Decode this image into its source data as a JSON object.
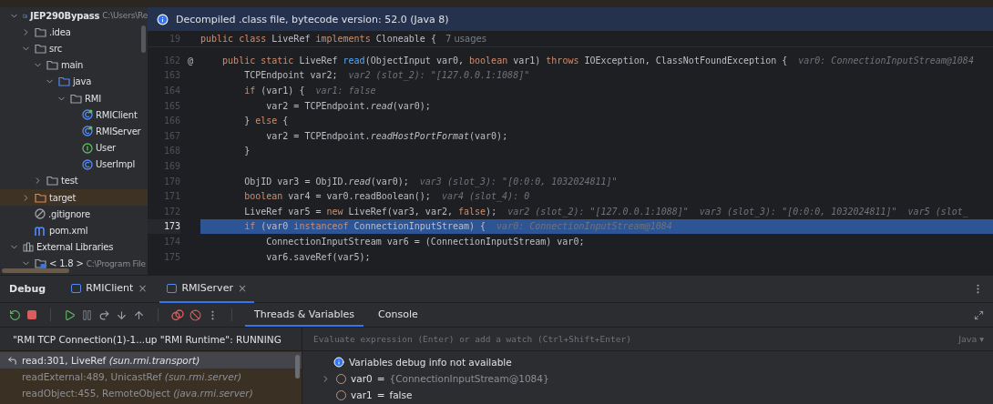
{
  "project_tree": [
    {
      "label": "JEP290Bypass",
      "hint": "C:\\Users\\Re",
      "kind": "module",
      "expanded": true,
      "children": [
        {
          "label": ".idea",
          "kind": "folder",
          "expanded": false
        },
        {
          "label": "src",
          "kind": "folder",
          "expanded": true,
          "children": [
            {
              "label": "main",
              "kind": "folder",
              "expanded": true,
              "children": [
                {
                  "label": "java",
                  "kind": "source-folder",
                  "expanded": true,
                  "children": [
                    {
                      "label": "RMI",
                      "kind": "package",
                      "expanded": true,
                      "children": [
                        {
                          "label": "RMIClient",
                          "kind": "main-class"
                        },
                        {
                          "label": "RMIServer",
                          "kind": "main-class"
                        },
                        {
                          "label": "User",
                          "kind": "interface"
                        },
                        {
                          "label": "UserImpl",
                          "kind": "class"
                        }
                      ]
                    }
                  ]
                }
              ]
            },
            {
              "label": "test",
              "kind": "folder",
              "expanded": false
            }
          ]
        },
        {
          "label": "target",
          "kind": "excluded-folder",
          "expanded": false
        },
        {
          "label": ".gitignore",
          "kind": "ignore"
        },
        {
          "label": "pom.xml",
          "kind": "maven"
        }
      ]
    },
    {
      "label": "External Libraries",
      "kind": "library",
      "expanded": true,
      "children": [
        {
          "label": "< 1.8 >",
          "hint": "C:\\Program File",
          "kind": "jdk",
          "expanded": true
        }
      ]
    }
  ],
  "banner": {
    "text": "Decompiled .class file, bytecode version: 52.0 (Java 8)"
  },
  "sticky_line": {
    "number": "19",
    "tokens": [
      {
        "kind": "kw",
        "text": "public class "
      },
      {
        "kind": "plain",
        "text": "LiveRef "
      },
      {
        "kind": "kw",
        "text": "implements "
      },
      {
        "kind": "plain",
        "text": "Cloneable {"
      },
      {
        "kind": "usage",
        "text": "7 usages"
      }
    ]
  },
  "code_lines": [
    {
      "number": "162",
      "marker": "@",
      "current": false,
      "tokens": [
        {
          "kind": "kw",
          "text": "    public static "
        },
        {
          "kind": "plain",
          "text": "LiveRef "
        },
        {
          "kind": "decl",
          "text": "read"
        },
        {
          "kind": "plain",
          "text": "(ObjectInput var0, "
        },
        {
          "kind": "kw",
          "text": "boolean "
        },
        {
          "kind": "plain",
          "text": "var1) "
        },
        {
          "kind": "kw",
          "text": "throws "
        },
        {
          "kind": "plain",
          "text": "IOException, ClassNotFoundException {"
        },
        {
          "kind": "hint",
          "text": "var0: ConnectionInputStream@1084"
        }
      ]
    },
    {
      "number": "163",
      "current": false,
      "tokens": [
        {
          "kind": "plain",
          "text": "        TCPEndpoint var2;"
        },
        {
          "kind": "hint",
          "text": "var2 (slot_2): \"[127.0.0.1:1088]\""
        }
      ]
    },
    {
      "number": "164",
      "current": false,
      "tokens": [
        {
          "kind": "kw",
          "text": "        if "
        },
        {
          "kind": "plain",
          "text": "(var1) {"
        },
        {
          "kind": "hint",
          "text": "var1: false"
        }
      ]
    },
    {
      "number": "165",
      "current": false,
      "tokens": [
        {
          "kind": "plain",
          "text": "            var2 = TCPEndpoint."
        },
        {
          "kind": "static",
          "text": "read"
        },
        {
          "kind": "plain",
          "text": "(var0);"
        }
      ]
    },
    {
      "number": "166",
      "current": false,
      "tokens": [
        {
          "kind": "plain",
          "text": "        } "
        },
        {
          "kind": "kw",
          "text": "else "
        },
        {
          "kind": "plain",
          "text": "{"
        }
      ]
    },
    {
      "number": "167",
      "current": false,
      "tokens": [
        {
          "kind": "plain",
          "text": "            var2 = TCPEndpoint."
        },
        {
          "kind": "static",
          "text": "readHostPortFormat"
        },
        {
          "kind": "plain",
          "text": "(var0);"
        }
      ]
    },
    {
      "number": "168",
      "current": false,
      "tokens": [
        {
          "kind": "plain",
          "text": "        }"
        }
      ]
    },
    {
      "number": "169",
      "current": false
    },
    {
      "number": "170",
      "current": false,
      "tokens": [
        {
          "kind": "plain",
          "text": "        ObjID var3 = ObjID."
        },
        {
          "kind": "static",
          "text": "read"
        },
        {
          "kind": "plain",
          "text": "(var0);"
        },
        {
          "kind": "hint",
          "text": "var3 (slot_3): \"[0:0:0, 1032024811]\""
        }
      ]
    },
    {
      "number": "171",
      "current": false,
      "tokens": [
        {
          "kind": "kw",
          "text": "        boolean "
        },
        {
          "kind": "plain",
          "text": "var4 = var0.readBoolean();"
        },
        {
          "kind": "hint",
          "text": "var4 (slot_4): 0"
        }
      ]
    },
    {
      "number": "172",
      "current": false,
      "tokens": [
        {
          "kind": "plain",
          "text": "        LiveRef var5 = "
        },
        {
          "kind": "kw",
          "text": "new "
        },
        {
          "kind": "plain",
          "text": "LiveRef(var3, var2, "
        },
        {
          "kind": "kw",
          "text": "false"
        },
        {
          "kind": "plain",
          "text": ");"
        },
        {
          "kind": "hint",
          "text": "var2 (slot_2): \"[127.0.0.1:1088]\""
        },
        {
          "kind": "hint",
          "text": "var3 (slot_3): \"[0:0:0, 1032024811]\""
        },
        {
          "kind": "hint",
          "text": "var5 (slot_"
        }
      ]
    },
    {
      "number": "173",
      "current": true,
      "tokens": [
        {
          "kind": "kw",
          "text": "        if "
        },
        {
          "kind": "plain",
          "text": "(var0 "
        },
        {
          "kind": "kw",
          "text": "instanceof "
        },
        {
          "kind": "plain",
          "text": "ConnectionInputStream) {"
        },
        {
          "kind": "hint",
          "text": "var0: ConnectionInputStream@1084"
        }
      ]
    },
    {
      "number": "174",
      "current": false,
      "tokens": [
        {
          "kind": "plain",
          "text": "            ConnectionInputStream var6 = (ConnectionInputStream) var0;"
        }
      ]
    },
    {
      "number": "175",
      "current": false,
      "tokens": [
        {
          "kind": "plain",
          "text": "            var6.saveRef(var5);"
        }
      ]
    }
  ],
  "debug": {
    "title": "Debug",
    "tabs": [
      {
        "label": "RMIClient",
        "close": "×",
        "selected": false
      },
      {
        "label": "RMIServer",
        "close": "×",
        "selected": true
      }
    ],
    "subtabs": [
      {
        "label": "Threads & Variables",
        "selected": true
      },
      {
        "label": "Console",
        "selected": false
      }
    ],
    "thread": "\"RMI TCP Connection(1)-1...up \"RMI Runtime\": RUNNING",
    "evaluate": {
      "placeholder": "Evaluate expression (Enter) or add a watch (Ctrl+Shift+Enter)",
      "language": "Java ▾"
    },
    "frames": [
      {
        "text": "read:301, LiveRef *(sun.rmi.transport)*",
        "selected": true
      },
      {
        "text": "readExternal:489, UnicastRef *(sun.rmi.server)*",
        "selected": false
      },
      {
        "text": "readObject:455, RemoteObject *(java.rmi.server)*",
        "selected": false
      }
    ],
    "variables_info": "Variables debug info not available",
    "variables": [
      {
        "name": "var0",
        "operator": "=",
        "value": "{ConnectionInputStream@1084}",
        "expandable": true
      },
      {
        "name": "var1",
        "operator": "=",
        "value": "false",
        "expandable": false
      }
    ]
  }
}
